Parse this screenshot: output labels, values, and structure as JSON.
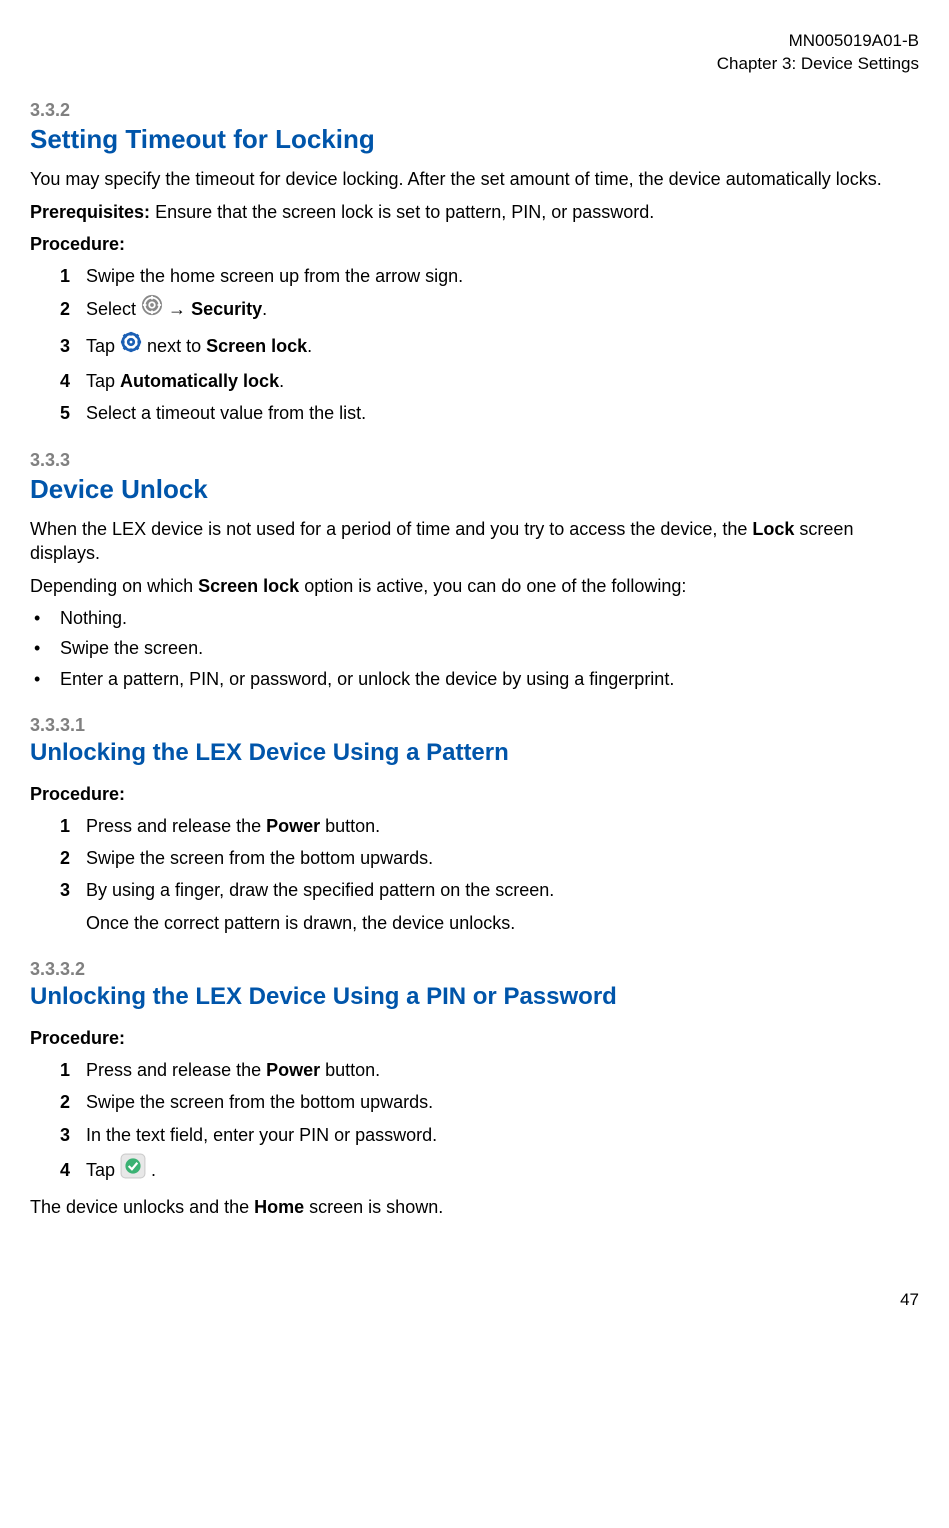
{
  "header": {
    "doc_id": "MN005019A01-B",
    "chapter": "Chapter 3:  Device Settings"
  },
  "s332": {
    "num": "3.3.2",
    "title": "Setting Timeout for Locking",
    "intro": "You may specify the timeout for device locking. After the set amount of time, the device automatically locks.",
    "prereq_label": "Prerequisites:",
    "prereq_text": " Ensure that the screen lock is set to pattern, PIN, or password.",
    "procedure_label": "Procedure:",
    "steps": {
      "s1": "Swipe the home screen up from the arrow sign.",
      "s2_a": "Select ",
      "s2_b": " → ",
      "s2_c": "Security",
      "s2_d": ".",
      "s3_a": "Tap ",
      "s3_b": " next to ",
      "s3_c": "Screen lock",
      "s3_d": ".",
      "s4_a": "Tap ",
      "s4_b": "Automatically lock",
      "s4_c": ".",
      "s5": "Select a timeout value from the list."
    }
  },
  "s333": {
    "num": "3.3.3",
    "title": "Device Unlock",
    "p1_a": "When the LEX device is not used for a period of time and you try to access the device, the ",
    "p1_b": "Lock",
    "p1_c": " screen displays.",
    "p2_a": "Depending on which ",
    "p2_b": "Screen lock",
    "p2_c": " option is active, you can do one of the following:",
    "bullets": {
      "b1": "Nothing.",
      "b2": "Swipe the screen.",
      "b3": "Enter a pattern, PIN, or password, or unlock the device by using a fingerprint."
    }
  },
  "s3331": {
    "num": "3.3.3.1",
    "title": "Unlocking the LEX Device Using a Pattern",
    "procedure_label": "Procedure:",
    "steps": {
      "s1_a": "Press and release the ",
      "s1_b": "Power",
      "s1_c": " button.",
      "s2": "Swipe the screen from the bottom upwards.",
      "s3": "By using a finger, draw the specified pattern on the screen.",
      "s3_note": "Once the correct pattern is drawn, the device unlocks."
    }
  },
  "s3332": {
    "num": "3.3.3.2",
    "title": "Unlocking the LEX Device Using a PIN or Password",
    "procedure_label": "Procedure:",
    "steps": {
      "s1_a": "Press and release the ",
      "s1_b": "Power",
      "s1_c": " button.",
      "s2": "Swipe the screen from the bottom upwards.",
      "s3": "In the text field, enter your PIN or password.",
      "s4_a": "Tap ",
      "s4_b": "."
    },
    "outro_a": "The device unlocks and the ",
    "outro_b": "Home",
    "outro_c": " screen is shown."
  },
  "footer": {
    "page": "47"
  }
}
